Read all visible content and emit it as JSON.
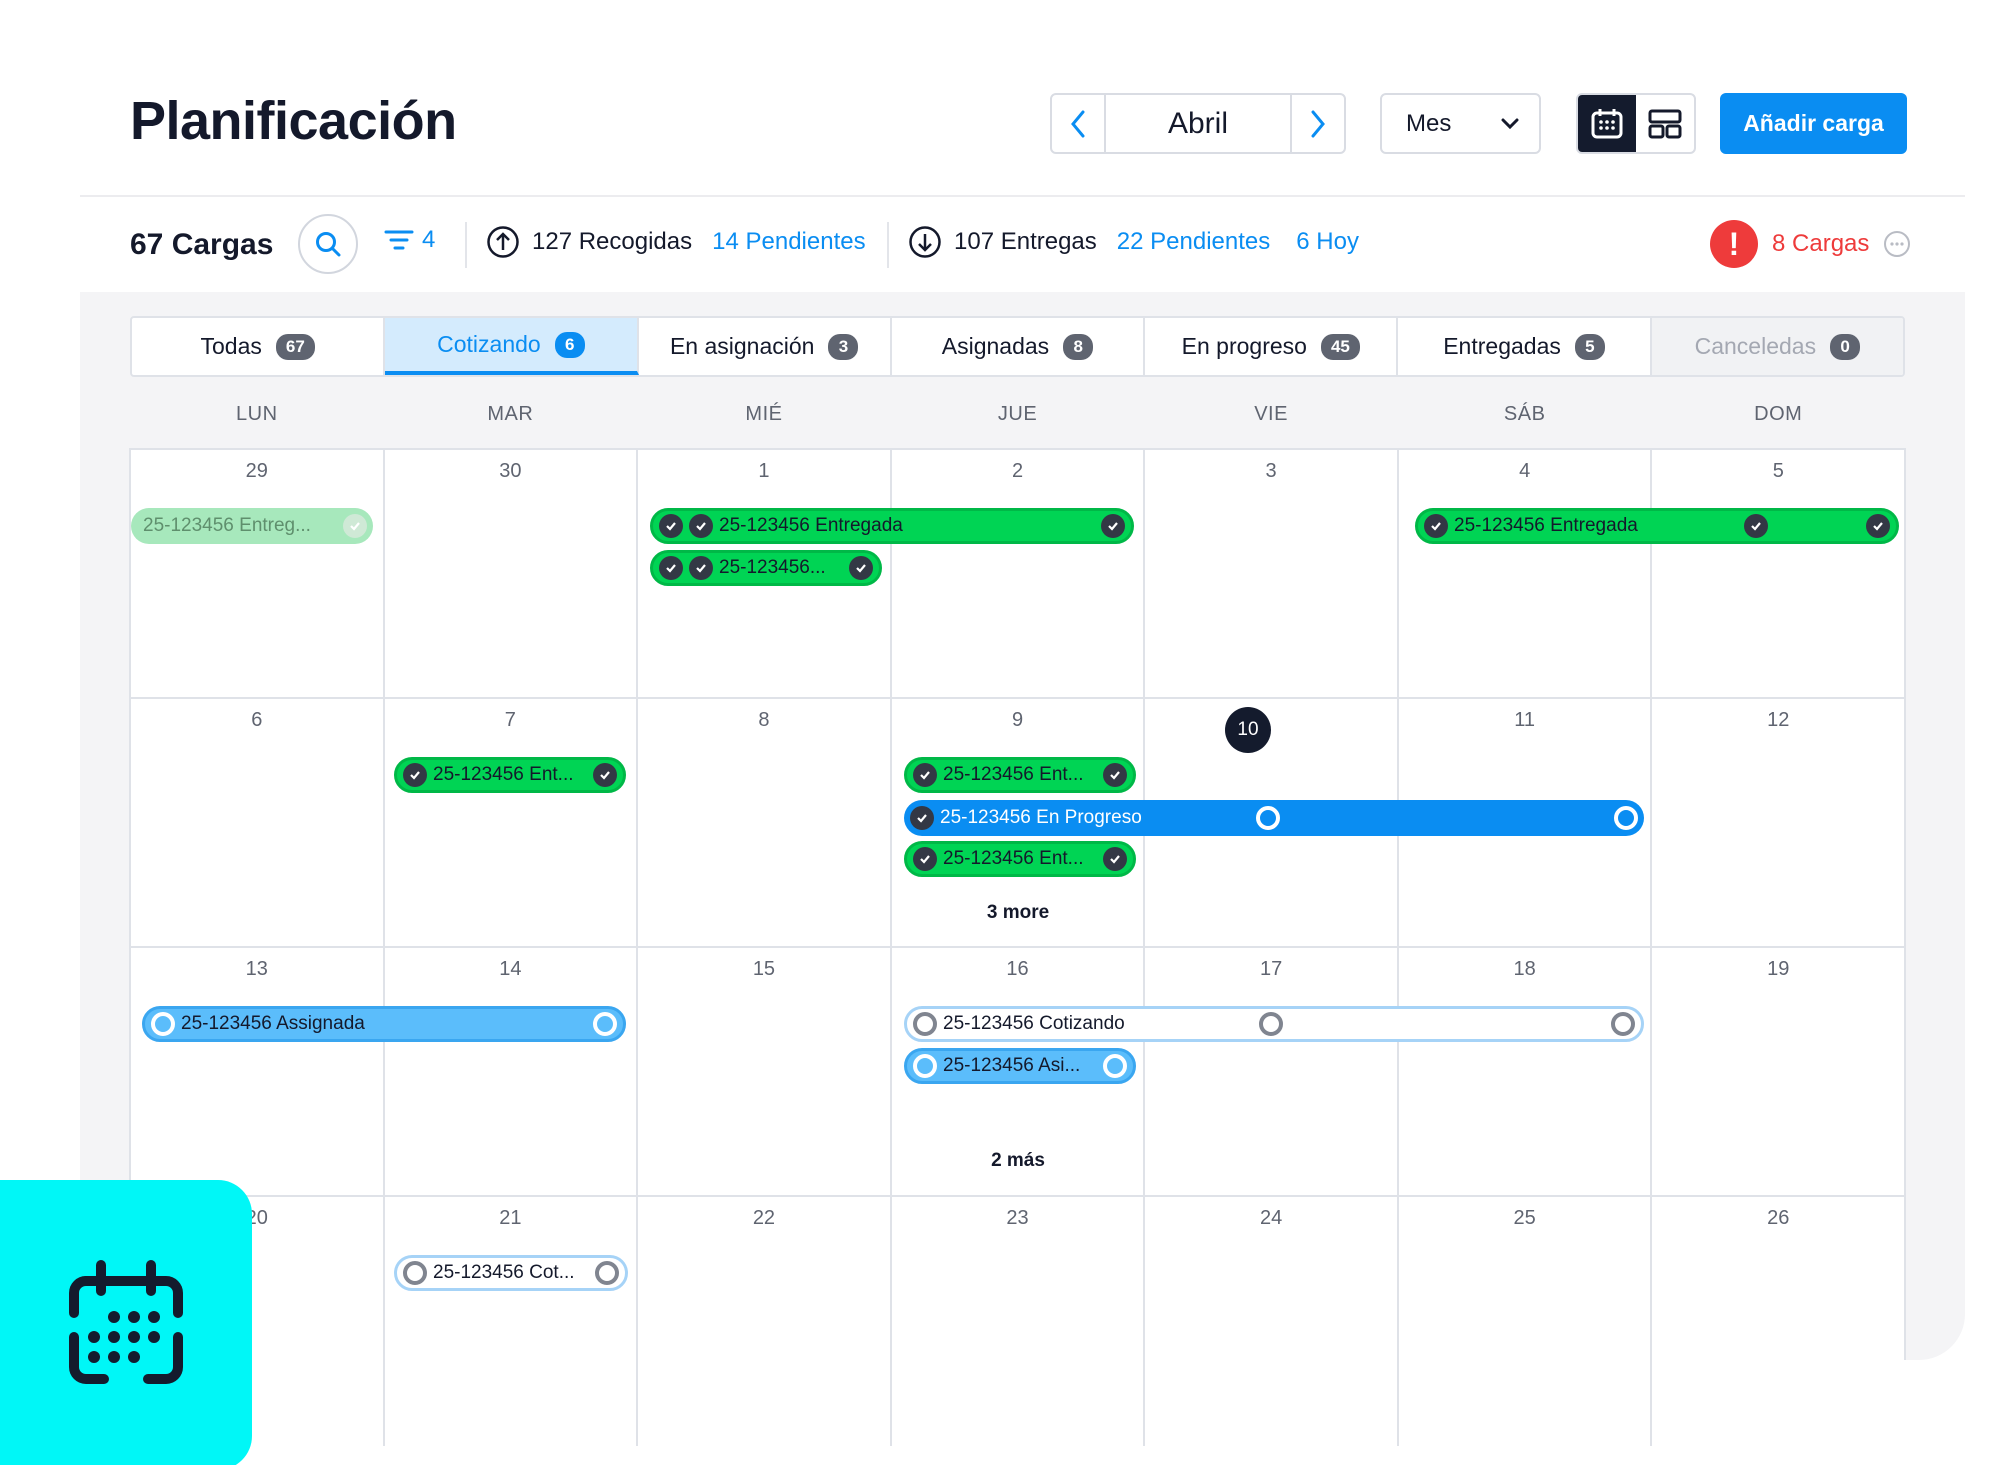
{
  "header": {
    "title": "Planificación",
    "month": "Abril",
    "view_select": "Mes",
    "add_button": "Añadir carga"
  },
  "stats": {
    "cargas": "67 Cargas",
    "filter_count": "4",
    "recogidas": "127 Recogidas",
    "recogidas_pendientes": "14 Pendientes",
    "entregas": "107 Entregas",
    "entregas_pendientes": "22 Pendientes",
    "hoy": "6 Hoy",
    "alert_text": "8 Cargas"
  },
  "tabs": [
    {
      "label": "Todas",
      "count": "67"
    },
    {
      "label": "Cotizando",
      "count": "6"
    },
    {
      "label": "En asignación",
      "count": "3"
    },
    {
      "label": "Asignadas",
      "count": "8"
    },
    {
      "label": "En progreso",
      "count": "45"
    },
    {
      "label": "Entregadas",
      "count": "5"
    },
    {
      "label": "Canceledas",
      "count": "0"
    }
  ],
  "weekdays": [
    "LUN",
    "MAR",
    "MIÉ",
    "JUE",
    "VIE",
    "SÁB",
    "DOM"
  ],
  "weeks": [
    [
      "29",
      "30",
      "1",
      "2",
      "3",
      "4",
      "5"
    ],
    [
      "6",
      "7",
      "8",
      "9",
      "10",
      "11",
      "12"
    ],
    [
      "13",
      "14",
      "15",
      "16",
      "17",
      "18",
      "19"
    ],
    [
      "20",
      "21",
      "22",
      "23",
      "24",
      "25",
      "26"
    ]
  ],
  "today": "10",
  "events": {
    "w1_faded": "25-123456 Entreg...",
    "w1_long": "25-123456 Entregada",
    "w1_short": "25-123456...",
    "w1_sat": "25-123456 Entregada",
    "w2_tue": "25-123456 Ent...",
    "w2_thu_a": "25-123456 Ent...",
    "w2_progress": "25-123456 En Progreso",
    "w2_thu_b": "25-123456 Ent...",
    "w3_assigned": "25-123456 Assignada",
    "w3_quote": "25-123456 Cotizando",
    "w3_asi": "25-123456 Asi...",
    "w4_quote": "25-123456 Cot..."
  },
  "more": {
    "w2_thu": "3 more",
    "w3_thu": "2 más"
  },
  "colors": {
    "accent": "#0a8df2",
    "green": "#00d454",
    "dark": "#141b2d",
    "alert": "#ee3b3b",
    "badge": "#00f7f7"
  }
}
